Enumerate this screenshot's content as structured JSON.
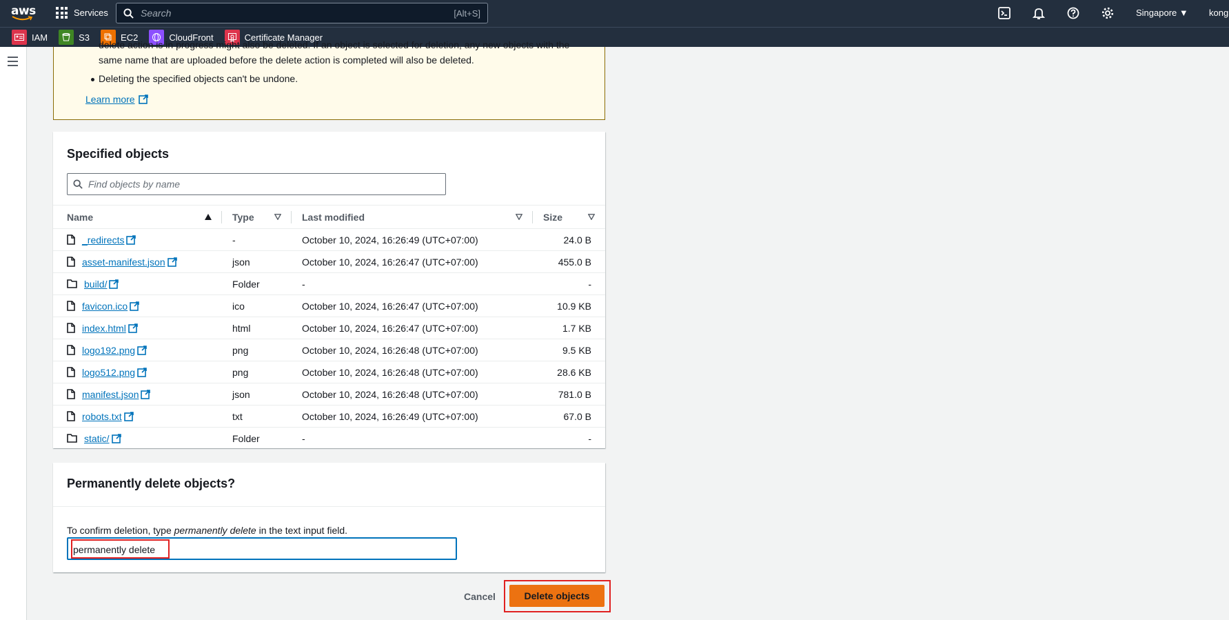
{
  "topbar": {
    "logo": "aws",
    "services_label": "Services",
    "search_placeholder": "Search",
    "search_shortcut": "[Alt+S]",
    "region": "Singapore ▼",
    "account": "kong"
  },
  "favorites": [
    {
      "label": "IAM",
      "color": "#dd344c"
    },
    {
      "label": "S3",
      "color": "#3f8624"
    },
    {
      "label": "EC2",
      "color": "#ed7100"
    },
    {
      "label": "CloudFront",
      "color": "#8c4fff"
    },
    {
      "label": "Certificate Manager",
      "color": "#dd344c"
    }
  ],
  "warning": {
    "cut_line": "delete action is in progress might also be deleted. If an object is selected for deletion, any new objects with the",
    "line2": "same name that are uploaded before the delete action is completed will also be deleted.",
    "bullet2": "Deleting the specified objects can't be undone.",
    "learn_more": "Learn more"
  },
  "specified": {
    "title": "Specified objects",
    "find_placeholder": "Find objects by name",
    "columns": [
      "Name",
      "Type",
      "Last modified",
      "Size"
    ],
    "rows": [
      {
        "name": "_redirects",
        "icon": "file",
        "type": "-",
        "modified": "October 10, 2024, 16:26:49 (UTC+07:00)",
        "size": "24.0 B"
      },
      {
        "name": "asset-manifest.json",
        "icon": "file",
        "type": "json",
        "modified": "October 10, 2024, 16:26:47 (UTC+07:00)",
        "size": "455.0 B"
      },
      {
        "name": "build/",
        "icon": "folder",
        "type": "Folder",
        "modified": "-",
        "size": "-"
      },
      {
        "name": "favicon.ico",
        "icon": "file",
        "type": "ico",
        "modified": "October 10, 2024, 16:26:47 (UTC+07:00)",
        "size": "10.9 KB"
      },
      {
        "name": "index.html",
        "icon": "file",
        "type": "html",
        "modified": "October 10, 2024, 16:26:47 (UTC+07:00)",
        "size": "1.7 KB"
      },
      {
        "name": "logo192.png",
        "icon": "file",
        "type": "png",
        "modified": "October 10, 2024, 16:26:48 (UTC+07:00)",
        "size": "9.5 KB"
      },
      {
        "name": "logo512.png",
        "icon": "file",
        "type": "png",
        "modified": "October 10, 2024, 16:26:48 (UTC+07:00)",
        "size": "28.6 KB"
      },
      {
        "name": "manifest.json",
        "icon": "file",
        "type": "json",
        "modified": "October 10, 2024, 16:26:48 (UTC+07:00)",
        "size": "781.0 B"
      },
      {
        "name": "robots.txt",
        "icon": "file",
        "type": "txt",
        "modified": "October 10, 2024, 16:26:49 (UTC+07:00)",
        "size": "67.0 B"
      },
      {
        "name": "static/",
        "icon": "folder",
        "type": "Folder",
        "modified": "-",
        "size": "-"
      }
    ]
  },
  "confirm": {
    "title": "Permanently delete objects?",
    "label_pre": "To confirm deletion, type ",
    "label_em": "permanently delete",
    "label_post": " in the text input field.",
    "input_value": "permanently delete"
  },
  "actions": {
    "cancel": "Cancel",
    "delete": "Delete objects"
  }
}
